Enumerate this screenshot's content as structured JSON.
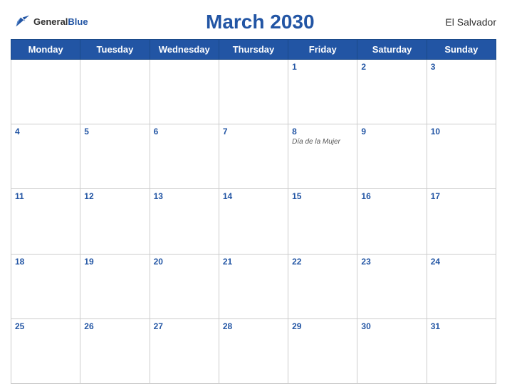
{
  "header": {
    "title": "March 2030",
    "country": "El Salvador",
    "logo_general": "General",
    "logo_blue": "Blue"
  },
  "days_of_week": [
    "Monday",
    "Tuesday",
    "Wednesday",
    "Thursday",
    "Friday",
    "Saturday",
    "Sunday"
  ],
  "weeks": [
    [
      {
        "day": "",
        "empty": true
      },
      {
        "day": "",
        "empty": true
      },
      {
        "day": "",
        "empty": true
      },
      {
        "day": "",
        "empty": true
      },
      {
        "day": "1"
      },
      {
        "day": "2"
      },
      {
        "day": "3"
      }
    ],
    [
      {
        "day": "4"
      },
      {
        "day": "5"
      },
      {
        "day": "6"
      },
      {
        "day": "7"
      },
      {
        "day": "8",
        "event": "Día de la Mujer"
      },
      {
        "day": "9"
      },
      {
        "day": "10"
      }
    ],
    [
      {
        "day": "11"
      },
      {
        "day": "12"
      },
      {
        "day": "13"
      },
      {
        "day": "14"
      },
      {
        "day": "15"
      },
      {
        "day": "16"
      },
      {
        "day": "17"
      }
    ],
    [
      {
        "day": "18"
      },
      {
        "day": "19"
      },
      {
        "day": "20"
      },
      {
        "day": "21"
      },
      {
        "day": "22"
      },
      {
        "day": "23"
      },
      {
        "day": "24"
      }
    ],
    [
      {
        "day": "25"
      },
      {
        "day": "26"
      },
      {
        "day": "27"
      },
      {
        "day": "28"
      },
      {
        "day": "29"
      },
      {
        "day": "30"
      },
      {
        "day": "31"
      }
    ]
  ]
}
